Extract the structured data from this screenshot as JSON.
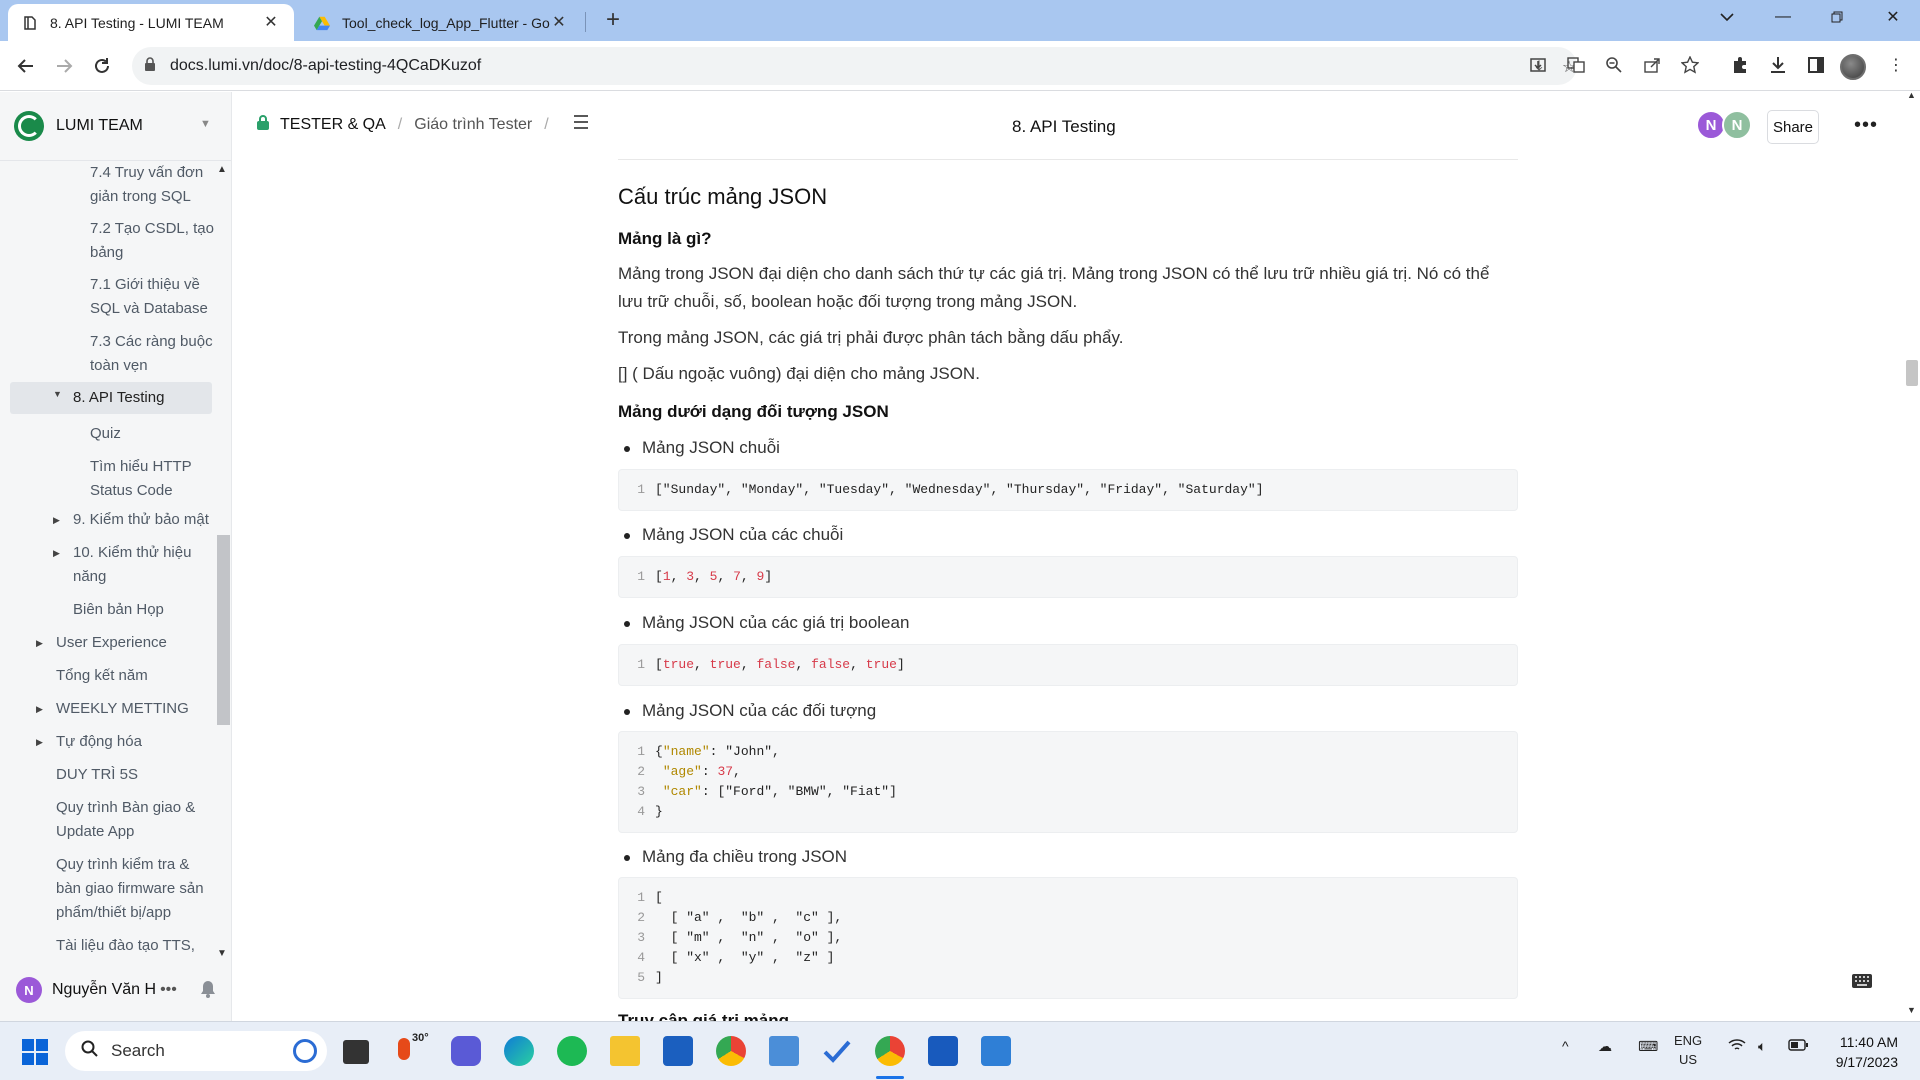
{
  "browser": {
    "tabs": [
      {
        "title": "8. API Testing - LUMI TEAM",
        "active": true
      },
      {
        "title": "Tool_check_log_App_Flutter - Goo",
        "active": false
      }
    ],
    "url": "docs.lumi.vn/doc/8-api-testing-4QCaDKuzof"
  },
  "sidebar": {
    "workspace": "LUMI TEAM",
    "items": [
      {
        "label": "7.4 Truy vấn đơn",
        "label2": "giản trong SQL"
      },
      {
        "label": "7.2 Tạo CSDL, tạo",
        "label2": "bảng"
      },
      {
        "label": "7.1 Giới thiệu về",
        "label2": "SQL và Database"
      },
      {
        "label": "7.3 Các ràng buộc",
        "label2": "toàn vẹn"
      },
      {
        "label": "8. API Testing"
      },
      {
        "label": "Quiz"
      },
      {
        "label": "Tìm hiểu HTTP",
        "label2": "Status Code"
      },
      {
        "label": "9. Kiểm thử bảo mật"
      },
      {
        "label": "10. Kiểm thử hiệu",
        "label2": "năng"
      },
      {
        "label": "Biên bản Họp"
      },
      {
        "label": "User Experience"
      },
      {
        "label": "Tổng kết năm"
      },
      {
        "label": "WEEKLY METTING"
      },
      {
        "label": "Tự động hóa"
      },
      {
        "label": "DUY TRÌ 5S"
      },
      {
        "label": "Quy trình Bàn giao &",
        "label2": "Update App"
      },
      {
        "label": "Quy trình kiểm tra &",
        "label2": "bàn giao firmware sản",
        "label3": "phẩm/thiết bị/app"
      },
      {
        "label": "Tài liệu đào tạo TTS,"
      }
    ],
    "user": {
      "initial": "N",
      "name": "Nguyễn Văn H"
    }
  },
  "header": {
    "breadcrumb": [
      "TESTER & QA",
      "Giáo trình Tester"
    ],
    "title": "8. API Testing",
    "avatars": [
      {
        "initial": "N",
        "color": "#9b59d8"
      },
      {
        "initial": "N",
        "color": "#8fbf9f"
      }
    ],
    "share": "Share"
  },
  "doc": {
    "h2": "Cấu trúc mảng JSON",
    "h3_what": "Mảng là gì?",
    "p1a": "Mảng trong JSON đại diện cho danh sách thứ tự các giá trị. Mảng trong JSON có thể lưu trữ nhiều giá trị. Nó có thể",
    "p1b": "lưu trữ chuỗi, số, boolean hoặc đối tượng trong mảng JSON.",
    "p2": "Trong mảng JSON, các giá trị phải được phân tách bằng dấu phẩy.",
    "p3": "[] ( Dấu ngoặc vuông) đại diện cho mảng JSON.",
    "h3_obj": "Mảng dưới dạng đối tượng JSON",
    "bullets": [
      "Mảng JSON chuỗi",
      "Mảng JSON của các chuỗi",
      "Mảng JSON của các giá trị boolean",
      "Mảng JSON của các đối tượng",
      "Mảng đa chiều trong JSON"
    ],
    "code1": "[\"Sunday\", \"Monday\", \"Tuesday\", \"Wednesday\", \"Thursday\", \"Friday\", \"Saturday\"]",
    "code2": [
      "1",
      "3",
      "5",
      "7",
      "9"
    ],
    "code3": [
      "true",
      "true",
      "false",
      "false",
      "true"
    ],
    "code4": {
      "k1": "\"name\"",
      "v1": "\"John\"",
      "k2": "\"age\"",
      "v2": "37",
      "k3": "\"car\"",
      "v3": "[\"Ford\", \"BMW\", \"Fiat\"]"
    },
    "code5": [
      "[",
      "  [ \"a\" ,  \"b\" ,  \"c\" ],",
      "  [ \"m\" ,  \"n\" ,  \"o\" ],",
      "  [ \"x\" ,  \"y\" ,  \"z\" ]",
      "]"
    ],
    "cut_heading": "Truy cập giá trị mảng"
  },
  "taskbar": {
    "search": "Search",
    "weather": "30°",
    "lang1": "ENG",
    "lang2": "US",
    "time": "11:40 AM",
    "date": "9/17/2023"
  }
}
